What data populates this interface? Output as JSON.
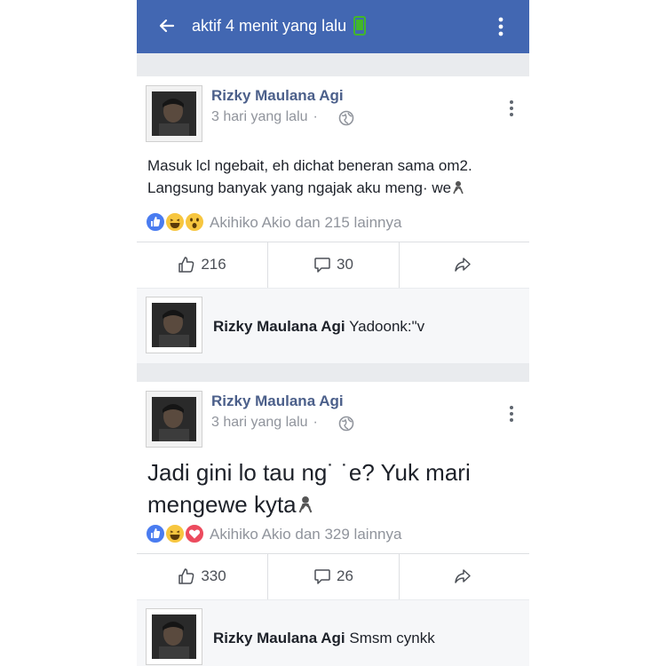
{
  "header": {
    "back_icon": "arrow-left-icon",
    "title": "aktif 4 menit yang lalu",
    "status_icon": "mobile-phone-icon",
    "status_color": "#42b72a",
    "menu_icon": "vertical-dots-icon",
    "background": "#4267b2"
  },
  "posts": [
    {
      "author": "Rizky Maulana Agi",
      "time": "3 hari yang lalu",
      "privacy_icon": "globe-icon",
      "text_line1": "Masuk lcl ngebait, eh dichat beneran sama om2.",
      "text_line2": "Langsung banyak yang ngajak aku meng· we",
      "reaction_icons": [
        "like-icon",
        "haha-icon",
        "wow-icon"
      ],
      "reaction_summary": "Akihiko Akio dan 215 lainnya",
      "like_count": "216",
      "comment_count": "30",
      "comment": {
        "author": "Rizky Maulana Agi",
        "text": "Yadoonk:\"v"
      }
    },
    {
      "author": "Rizky Maulana Agi",
      "time": "3 hari yang lalu",
      "privacy_icon": "globe-icon",
      "text_line1": "Jadi gini lo tau ng˙ ˙e? Yuk mari",
      "text_line2": "mengewe kyta",
      "reaction_icons": [
        "like-icon",
        "haha-icon",
        "love-icon"
      ],
      "reaction_summary": "Akihiko Akio dan 329 lainnya",
      "like_count": "330",
      "comment_count": "26",
      "comment": {
        "author": "Rizky Maulana Agi",
        "text": "Smsm cynkk"
      }
    }
  ]
}
